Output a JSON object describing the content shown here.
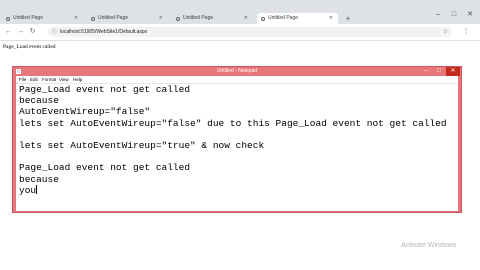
{
  "browser": {
    "tabs": [
      {
        "title": "Untitled Page",
        "active": false
      },
      {
        "title": "Untitled Page",
        "active": false
      },
      {
        "title": "Untitled Page",
        "active": false
      },
      {
        "title": "Untitled Page",
        "active": true
      }
    ],
    "url": "localhost:51905/WebSite1/Default.aspx"
  },
  "page": {
    "message": "Page_Load event called"
  },
  "notepad": {
    "title": "Untitled - Notepad",
    "menu": [
      "File",
      "Edit",
      "Format",
      "View",
      "Help"
    ],
    "lines": [
      "Page_Load event not get called",
      "because",
      "AutoEventWireup=\"false\"",
      "lets set AutoEventWireup=\"false\" due to this Page_Load event not get called",
      "",
      "lets set AutoEventWireup=\"true\" & now check",
      "",
      "Page_Load event not get called",
      "because",
      "you"
    ]
  },
  "watermark": "Activate Windows",
  "colors": {
    "notepad_frame": "#e8777c",
    "tabstrip": "#dee1e6"
  }
}
